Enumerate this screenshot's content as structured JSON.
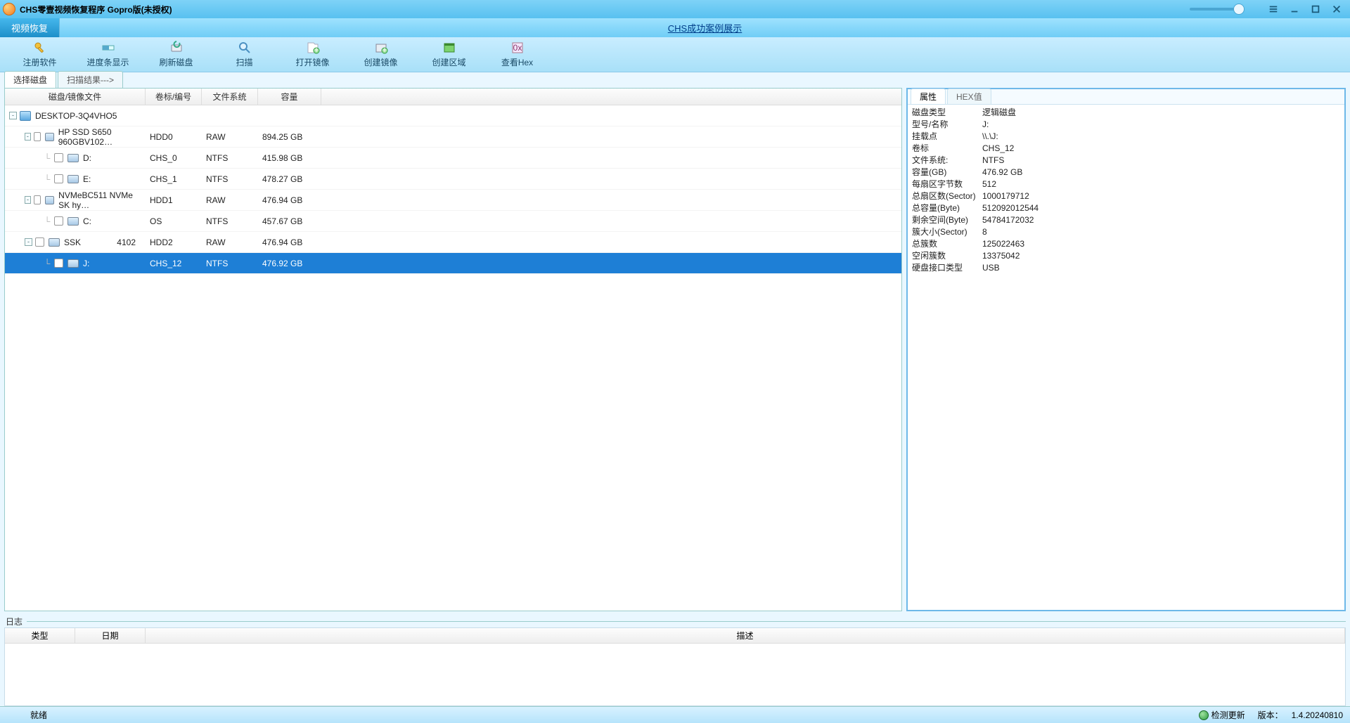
{
  "window": {
    "title": "CHS零壹视频恢复程序 Gopro版(未授权)"
  },
  "menubar": {
    "tab": "视频恢复",
    "link": "CHS成功案例展示"
  },
  "toolbar": [
    {
      "id": "register",
      "label": "注册软件"
    },
    {
      "id": "progress",
      "label": "进度条显示"
    },
    {
      "id": "refresh",
      "label": "刷新磁盘"
    },
    {
      "id": "scan",
      "label": "扫描"
    },
    {
      "id": "openimg",
      "label": "打开镜像"
    },
    {
      "id": "createimg",
      "label": "创建镜像"
    },
    {
      "id": "createregion",
      "label": "创建区域"
    },
    {
      "id": "viewhex",
      "label": "查看Hex"
    }
  ],
  "subtabs": {
    "active": "选择磁盘",
    "inactive": "扫描结果--->"
  },
  "grid": {
    "headers": [
      "磁盘/镜像文件",
      "卷标/编号",
      "文件系统",
      "容量"
    ],
    "rows": [
      {
        "depth": 0,
        "type": "pc",
        "toggle": "-",
        "name": "DESKTOP-3Q4VHO5",
        "vol": "",
        "fs": "",
        "cap": ""
      },
      {
        "depth": 1,
        "type": "disk",
        "toggle": "-",
        "chk": true,
        "name": "HP SSD S650 960GBV102…",
        "vol": "HDD0",
        "fs": "RAW",
        "cap": "894.25 GB"
      },
      {
        "depth": 2,
        "type": "vol",
        "chk": true,
        "name": "D:",
        "vol": "CHS_0",
        "fs": "NTFS",
        "cap": "415.98 GB"
      },
      {
        "depth": 2,
        "type": "vol",
        "chk": true,
        "name": "E:",
        "vol": "CHS_1",
        "fs": "NTFS",
        "cap": "478.27 GB"
      },
      {
        "depth": 1,
        "type": "disk",
        "toggle": "-",
        "chk": true,
        "name": "NVMeBC511 NVMe SK hy…",
        "vol": "HDD1",
        "fs": "RAW",
        "cap": "476.94 GB"
      },
      {
        "depth": 2,
        "type": "vol",
        "chk": true,
        "name": "C:",
        "vol": "OS",
        "fs": "NTFS",
        "cap": "457.67 GB"
      },
      {
        "depth": 1,
        "type": "disk",
        "toggle": "-",
        "chk": true,
        "name": "SSK",
        "extra": "4102",
        "vol": "HDD2",
        "fs": "RAW",
        "cap": "476.94 GB"
      },
      {
        "depth": 2,
        "type": "vol",
        "chk": true,
        "name": "J:",
        "vol": "CHS_12",
        "fs": "NTFS",
        "cap": "476.92 GB",
        "selected": true
      }
    ]
  },
  "rightTabs": {
    "active": "属性",
    "inactive": "HEX值"
  },
  "props": [
    {
      "k": "磁盘类型",
      "v": "逻辑磁盘"
    },
    {
      "k": "型号/名称",
      "v": "J:"
    },
    {
      "k": "挂载点",
      "v": "\\\\.\\J:"
    },
    {
      "k": "卷标",
      "v": "CHS_12"
    },
    {
      "k": "文件系统:",
      "v": "NTFS"
    },
    {
      "k": "容量(GB)",
      "v": "476.92 GB"
    },
    {
      "k": "每扇区字节数",
      "v": "512"
    },
    {
      "k": "总扇区数(Sector)",
      "v": "1000179712"
    },
    {
      "k": "总容量(Byte)",
      "v": "512092012544"
    },
    {
      "k": "剩余空间(Byte)",
      "v": "54784172032"
    },
    {
      "k": "簇大小(Sector)",
      "v": "8"
    },
    {
      "k": "总簇数",
      "v": "125022463"
    },
    {
      "k": "空闲簇数",
      "v": "13375042"
    },
    {
      "k": "硬盘接口类型",
      "v": "USB"
    }
  ],
  "log": {
    "title": "日志",
    "headers": [
      "类型",
      "日期",
      "描述"
    ]
  },
  "status": {
    "ready": "就绪",
    "update": "检测更新",
    "versionLabel": "版本：",
    "version": "1.4.20240810"
  }
}
